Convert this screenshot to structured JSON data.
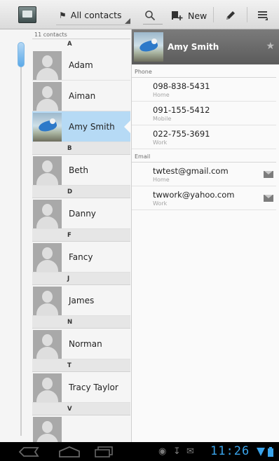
{
  "action_bar": {
    "account_label": "All contacts",
    "new_label": "New",
    "icons": [
      "contacts-app-icon",
      "contacts-group-icon",
      "search-icon",
      "add-contact-icon",
      "edit-icon",
      "overflow-menu-icon"
    ]
  },
  "list": {
    "count_label": "11 contacts",
    "sections": [
      {
        "letter": "A",
        "contacts": [
          {
            "name": "Adam"
          },
          {
            "name": "Aiman"
          },
          {
            "name": "Amy Smith",
            "selected": true,
            "has_photo": true
          }
        ]
      },
      {
        "letter": "B",
        "contacts": [
          {
            "name": "Beth"
          }
        ]
      },
      {
        "letter": "D",
        "contacts": [
          {
            "name": "Danny"
          }
        ]
      },
      {
        "letter": "F",
        "contacts": [
          {
            "name": "Fancy"
          }
        ]
      },
      {
        "letter": "J",
        "contacts": [
          {
            "name": "James"
          }
        ]
      },
      {
        "letter": "N",
        "contacts": [
          {
            "name": "Norman"
          }
        ]
      },
      {
        "letter": "T",
        "contacts": [
          {
            "name": "Tracy Taylor"
          }
        ]
      },
      {
        "letter": "V",
        "contacts": []
      }
    ]
  },
  "detail": {
    "name": "Amy Smith",
    "phone_label": "Phone",
    "phones": [
      {
        "number": "098-838-5431",
        "type": "Home"
      },
      {
        "number": "091-155-5412",
        "type": "Mobile"
      },
      {
        "number": "022-755-3691",
        "type": "Work"
      }
    ],
    "email_label": "Email",
    "emails": [
      {
        "address": "twtest@gmail.com",
        "type": "Home"
      },
      {
        "address": "twwork@yahoo.com",
        "type": "Work"
      }
    ]
  },
  "system_bar": {
    "time": "11:26",
    "icons": [
      "back-icon",
      "home-icon",
      "recent-apps-icon",
      "android-debug-icon",
      "usb-icon",
      "gmail-icon",
      "wifi-icon",
      "battery-icon"
    ]
  },
  "colors": {
    "selection": "#b6daf5",
    "accent": "#39a3ea",
    "header_gray": "#666666"
  }
}
